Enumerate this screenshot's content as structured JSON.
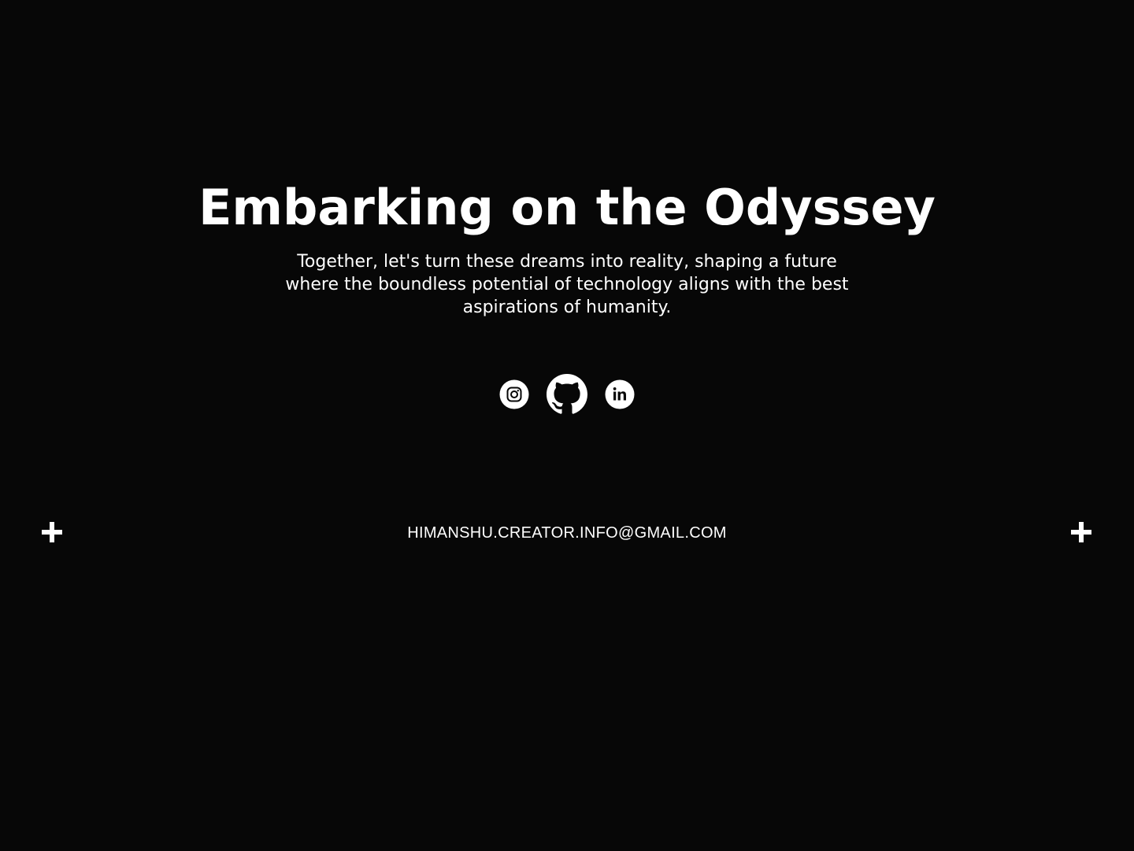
{
  "hero": {
    "title": "Embarking on the Odyssey",
    "subtitle": "Together, let's turn these dreams into reality, shaping a future where the boundless potential of technology aligns with the best aspirations of humanity."
  },
  "social": [
    {
      "name": "instagram",
      "icon": "instagram-icon"
    },
    {
      "name": "github",
      "icon": "github-icon"
    },
    {
      "name": "linkedin",
      "icon": "linkedin-icon"
    }
  ],
  "contact": {
    "email": "HIMANSHU.CREATOR.INFO@GMAIL.COM"
  },
  "colors": {
    "background": "#070707",
    "foreground": "#ffffff"
  }
}
